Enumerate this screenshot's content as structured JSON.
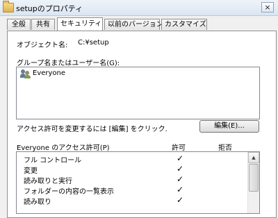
{
  "window": {
    "title": "setupのプロパティ",
    "close_glyph": "×"
  },
  "tabs": [
    {
      "label": "全般"
    },
    {
      "label": "共有"
    },
    {
      "label": "セキュリティ",
      "active": true
    },
    {
      "label": "以前のバージョン"
    },
    {
      "label": "カスタマイズ"
    }
  ],
  "security": {
    "object_name_label": "オブジェクト名:",
    "object_name_value": "C:¥setup",
    "groups_label": "グループ名またはユーザー名(G):",
    "groups": [
      {
        "name": "Everyone",
        "icon": "users-icon"
      }
    ],
    "change_hint": "アクセス許可を変更するには [編集] をクリック.",
    "edit_button": "編集(E)...",
    "permissions_header": "Everyone のアクセス許可(P)",
    "allow_header": "許可",
    "deny_header": "拒否",
    "permissions": [
      {
        "name": "フル コントロール",
        "allow": "✓"
      },
      {
        "name": "変更",
        "allow": "✓"
      },
      {
        "name": "読み取りと実行",
        "allow": "✓"
      },
      {
        "name": "フォルダーの内容の一覧表示",
        "allow": "✓"
      },
      {
        "name": "読み取り",
        "allow": "✓"
      }
    ]
  }
}
